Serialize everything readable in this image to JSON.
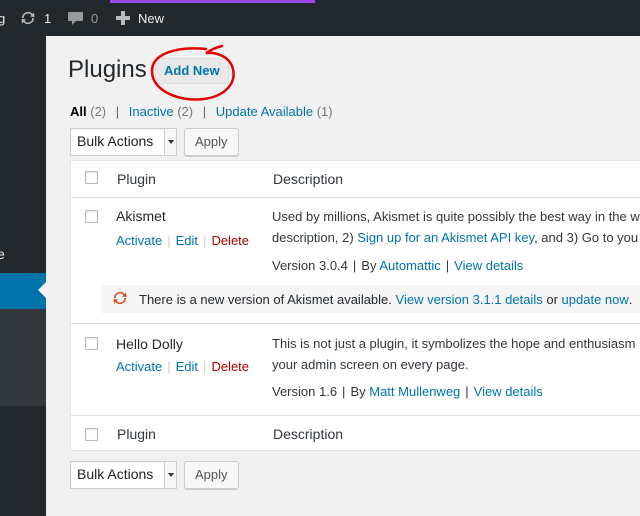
{
  "adminbar": {
    "site_letter": "g",
    "updates_count": "1",
    "comments_count": "0",
    "new_label": "New",
    "colors": {
      "background": "#23282d",
      "accent": "#9b49e9"
    }
  },
  "sidebar": {
    "letter_upper": "e"
  },
  "page": {
    "title": "Plugins",
    "add_new_label": "Add New"
  },
  "filters": {
    "all_label": "All",
    "all_count": "(2)",
    "inactive_label": "Inactive",
    "inactive_count": "(2)",
    "update_label": "Update Available",
    "update_count": "(1)",
    "separator": "|"
  },
  "bulk": {
    "select_value": "Bulk Actions",
    "apply_label": "Apply"
  },
  "table": {
    "col_plugin": "Plugin",
    "col_description": "Description",
    "plugins": [
      {
        "name": "Akismet",
        "activate": "Activate",
        "edit": "Edit",
        "delete": "Delete",
        "desc_line1": "Used by millions, Akismet is quite possibly the best way in the w",
        "desc_line2_pre": "description, 2) ",
        "desc_line2_link": "Sign up for an Akismet API key",
        "desc_line2_post": ", and 3) Go to you",
        "version": "Version 3.0.4",
        "by": "By",
        "author": "Automattic",
        "view_details": "View details",
        "update_notice": {
          "text": "There is a new version of Akismet available.",
          "link1": "View version 3.1.1 details",
          "or": "or",
          "link2": "update now",
          "end": "."
        }
      },
      {
        "name": "Hello Dolly",
        "activate": "Activate",
        "edit": "Edit",
        "delete": "Delete",
        "desc_line1": "This is not just a plugin, it symbolizes the hope and enthusiasm",
        "desc_line2": "your admin screen on every page.",
        "version": "Version 1.6",
        "by": "By",
        "author": "Matt Mullenweg",
        "view_details": "View details"
      }
    ]
  },
  "icons": [
    "updates-icon",
    "comment-icon",
    "plus-icon",
    "update-refresh-icon"
  ]
}
